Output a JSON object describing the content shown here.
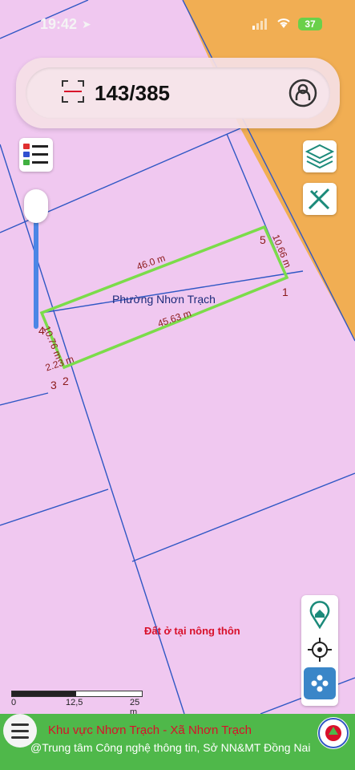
{
  "status_bar": {
    "time": "19:42",
    "location_arrow": "location-arrow-icon",
    "battery": "37"
  },
  "search": {
    "query": "143/385"
  },
  "map": {
    "parcel_label": "Phường Nhơn Trạch",
    "land_use_label": "Đất ở tại nông thôn",
    "edges": [
      "46.0 m",
      "10.66 m",
      "45.63 m",
      "10.76 m",
      "2.23 m"
    ],
    "vertices": [
      "1",
      "2",
      "3",
      "4",
      "5"
    ]
  },
  "scale_bar": {
    "labels": [
      "0",
      "12,5",
      "25 m"
    ]
  },
  "footer": {
    "region": "Khu vực Nhơn Trạch - Xã Nhơn Trạch",
    "credit": "@Trung tâm Công nghệ thông tin, Sở NN&MT Đồng Nai"
  },
  "colors": {
    "parcel_fill": "#f0c8f0",
    "boundary_line": "#2f57c4",
    "selected_parcel": "#7bdc4a",
    "road_area": "#f1ae53",
    "footer_bg": "#4fb84a",
    "footer_title": "#d8102a"
  }
}
